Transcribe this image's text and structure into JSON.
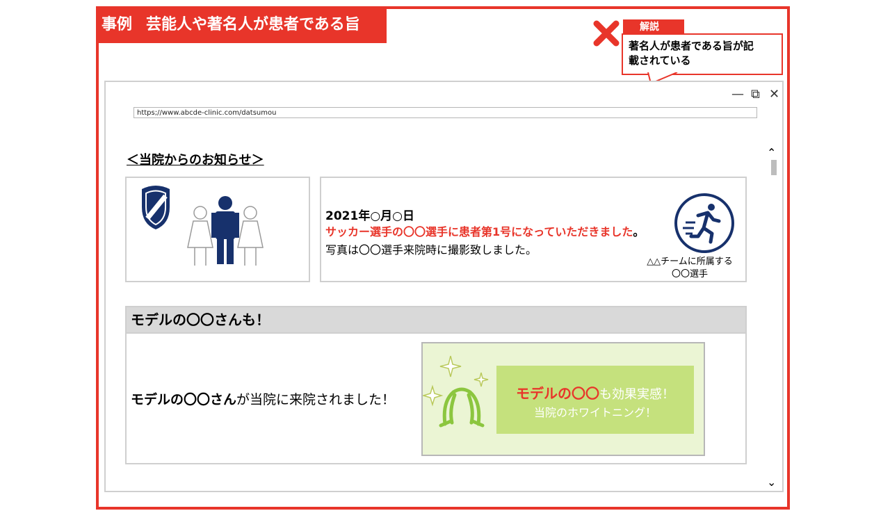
{
  "header": {
    "label": "事例",
    "title": "芸能人や著名人が患者である旨"
  },
  "callout": {
    "tag": "解説",
    "line1": "著名人が患者である旨が記",
    "line2": "載されている"
  },
  "browser": {
    "url": "https;//www.abcde-clinic.com/datsumou",
    "controls": {
      "minimize": "—",
      "restore": "⧉",
      "close": "✕"
    },
    "scroll_up": "⌃",
    "scroll_down": "⌄"
  },
  "notice": {
    "heading": "＜当院からのお知らせ＞",
    "date": "2021年○月○日",
    "highlight": "サッカー選手の〇〇選手に患者第1号になっていただきました",
    "highlight_end": "。",
    "body": "写真は〇〇選手来院時に撮影致しました。",
    "caption_line1": "△△チームに所属する",
    "caption_line2": "〇〇選手"
  },
  "model": {
    "heading": "モデルの〇〇さんも！",
    "text_bold": "モデルの〇〇さん",
    "text_rest": "が当院に来院されました！",
    "promo_red": "モデルの〇〇",
    "promo_rest": "も効果実感！",
    "promo_line2": "当院のホワイトニング！"
  },
  "colors": {
    "accent_red": "#e8352a",
    "navy": "#17316c",
    "promo_green": "#c5e17d",
    "promo_bg": "#ebf5d4"
  },
  "icons": [
    "cross-icon",
    "shield-icon",
    "people-icon",
    "runner-icon",
    "sparkle-icon",
    "hair-icon"
  ]
}
